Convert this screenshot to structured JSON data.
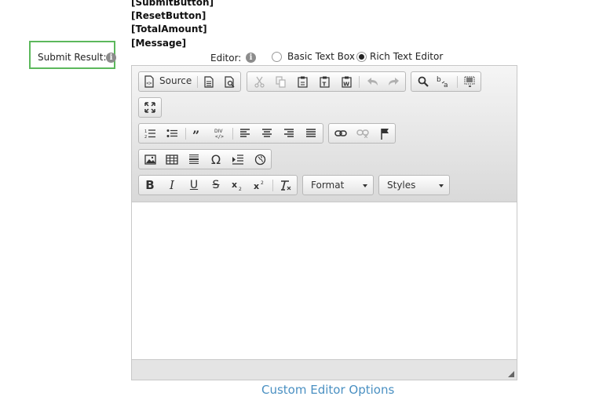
{
  "tokens": [
    "[SubmitButton]",
    "[ResetButton]",
    "[TotalAmount]",
    "[Message]"
  ],
  "submit_result": {
    "label": "Submit Result:",
    "info_icon": "info-icon"
  },
  "editor_option": {
    "label": "Editor:",
    "options": [
      {
        "label": "Basic Text Box",
        "selected": false
      },
      {
        "label": "Rich Text Editor",
        "selected": true
      }
    ]
  },
  "toolbar": {
    "source_label": "Source",
    "format_label": "Format",
    "styles_label": "Styles",
    "icons": [
      "source-icon",
      "new-page-icon",
      "preview-icon",
      "cut-icon",
      "copy-icon",
      "paste-icon",
      "paste-text-icon",
      "paste-word-icon",
      "undo-icon",
      "redo-icon",
      "find-icon",
      "replace-icon",
      "select-all-icon",
      "maximize-icon",
      "numbered-list-icon",
      "bulleted-list-icon",
      "blockquote-icon",
      "div-icon",
      "align-left-icon",
      "align-center-icon",
      "align-right-icon",
      "justify-icon",
      "link-icon",
      "unlink-icon",
      "anchor-icon",
      "image-icon",
      "table-icon",
      "horizontal-line-icon",
      "special-char-icon",
      "indent-icon",
      "iframe-icon",
      "bold-icon",
      "italic-icon",
      "underline-icon",
      "strike-icon",
      "subscript-icon",
      "superscript-icon",
      "remove-format-icon"
    ]
  },
  "footer_link": "Custom Editor Options"
}
